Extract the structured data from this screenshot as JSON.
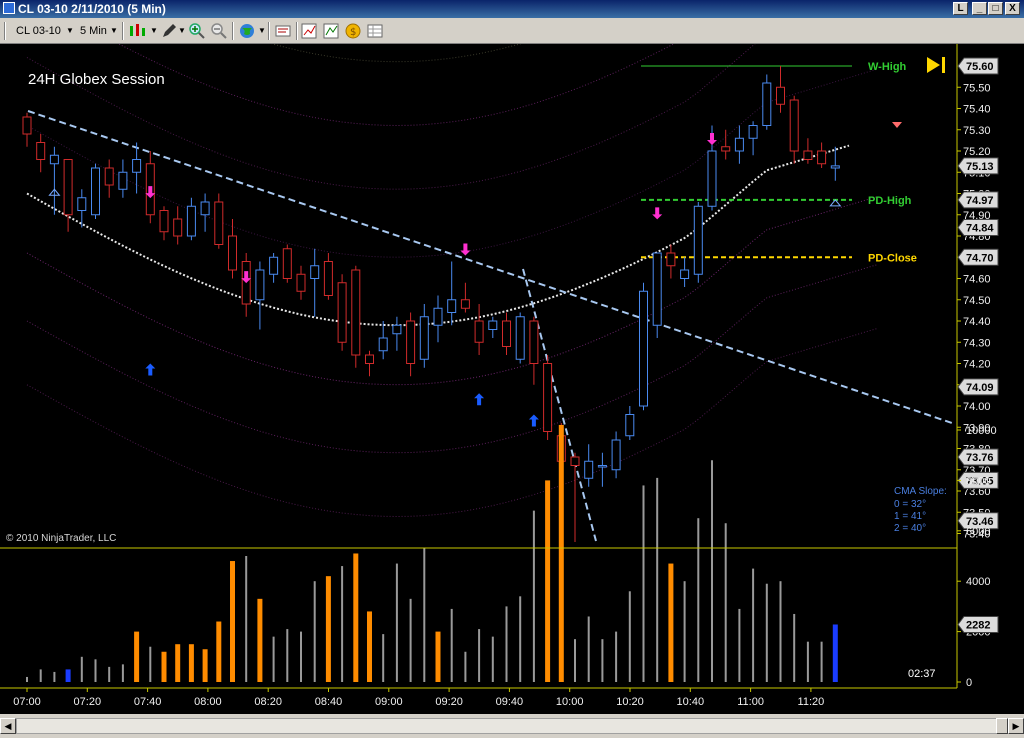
{
  "window": {
    "title": "CL 03-10  2/11/2010 (5 Min)",
    "controls": [
      "L",
      "_",
      "□",
      "X"
    ]
  },
  "toolbar": {
    "instrument": "CL 03-10",
    "interval": "5 Min",
    "icons": [
      "bars-icon",
      "pencil-icon",
      "zoom-in-icon",
      "zoom-out-icon",
      "globe-icon",
      "properties-icon",
      "chart-trader-icon",
      "coin-icon",
      "data-box-icon"
    ]
  },
  "chart": {
    "session_label": "24H Globex Session",
    "copyright": "© 2010 NinjaTrader, LLC",
    "price_ticks": [
      "75.50",
      "75.40",
      "75.30",
      "75.20",
      "75.10",
      "75.00",
      "74.90",
      "74.80",
      "74.70",
      "74.60",
      "74.50",
      "74.40",
      "74.30",
      "74.20",
      "74.10",
      "74.00",
      "73.90",
      "73.80",
      "73.70",
      "73.60",
      "73.50",
      "73.40"
    ],
    "price_labels": [
      {
        "value": "75.60",
        "color": "#dcdcdc"
      },
      {
        "value": "75.13",
        "color": "#dcdcdc"
      },
      {
        "value": "74.97",
        "color": "#dcdcdc"
      },
      {
        "value": "74.84",
        "color": "#dcdcdc"
      },
      {
        "value": "74.70",
        "color": "#dcdcdc"
      },
      {
        "value": "74.09",
        "color": "#dcdcdc"
      },
      {
        "value": "73.76",
        "color": "#dcdcdc"
      },
      {
        "value": "73.65",
        "color": "#dcdcdc"
      },
      {
        "value": "73.46",
        "color": "#dcdcdc"
      }
    ],
    "levels": [
      {
        "name": "W-High",
        "value": 75.6,
        "color": "#32cd32"
      },
      {
        "name": "PD-High",
        "value": 74.97,
        "color": "#32cd32"
      },
      {
        "name": "PD-Close",
        "value": 74.7,
        "color": "#ffd700"
      }
    ],
    "cma": {
      "title": "CMA Slope:",
      "lines": [
        "0 = 32°",
        "1 = 41°",
        "2 = 40°"
      ]
    },
    "volume_ticks": [
      "10000",
      "8000",
      "6000",
      "4000",
      "2000",
      "0"
    ],
    "volume_last": "2282",
    "time_ticks": [
      "07:00",
      "07:20",
      "07:40",
      "08:00",
      "08:20",
      "08:40",
      "09:00",
      "09:20",
      "09:40",
      "10:00",
      "10:20",
      "10:40",
      "11:00",
      "11:20"
    ],
    "timer": "02:37"
  },
  "chart_data": {
    "type": "candlestick",
    "interval": "5 Min",
    "candles": [
      {
        "o": 75.36,
        "h": 75.38,
        "l": 75.22,
        "c": 75.28
      },
      {
        "o": 75.24,
        "h": 75.28,
        "l": 75.1,
        "c": 75.16
      },
      {
        "o": 75.14,
        "h": 75.22,
        "l": 74.9,
        "c": 75.18
      },
      {
        "o": 75.16,
        "h": 75.16,
        "l": 74.82,
        "c": 74.9
      },
      {
        "o": 74.92,
        "h": 75.02,
        "l": 74.84,
        "c": 74.98
      },
      {
        "o": 74.9,
        "h": 75.14,
        "l": 74.88,
        "c": 75.12
      },
      {
        "o": 75.12,
        "h": 75.16,
        "l": 74.98,
        "c": 75.04
      },
      {
        "o": 75.02,
        "h": 75.16,
        "l": 74.98,
        "c": 75.1
      },
      {
        "o": 75.1,
        "h": 75.24,
        "l": 75.0,
        "c": 75.16
      },
      {
        "o": 75.14,
        "h": 75.2,
        "l": 74.86,
        "c": 74.9
      },
      {
        "o": 74.92,
        "h": 74.94,
        "l": 74.78,
        "c": 74.82
      },
      {
        "o": 74.88,
        "h": 74.94,
        "l": 74.76,
        "c": 74.8
      },
      {
        "o": 74.8,
        "h": 74.98,
        "l": 74.78,
        "c": 74.94
      },
      {
        "o": 74.9,
        "h": 75.0,
        "l": 74.82,
        "c": 74.96
      },
      {
        "o": 74.96,
        "h": 75.0,
        "l": 74.74,
        "c": 74.76
      },
      {
        "o": 74.8,
        "h": 74.88,
        "l": 74.6,
        "c": 74.64
      },
      {
        "o": 74.68,
        "h": 74.72,
        "l": 74.42,
        "c": 74.48
      },
      {
        "o": 74.5,
        "h": 74.68,
        "l": 74.36,
        "c": 74.64
      },
      {
        "o": 74.62,
        "h": 74.72,
        "l": 74.58,
        "c": 74.7
      },
      {
        "o": 74.74,
        "h": 74.76,
        "l": 74.58,
        "c": 74.6
      },
      {
        "o": 74.62,
        "h": 74.66,
        "l": 74.5,
        "c": 74.54
      },
      {
        "o": 74.6,
        "h": 74.74,
        "l": 74.42,
        "c": 74.66
      },
      {
        "o": 74.68,
        "h": 74.72,
        "l": 74.5,
        "c": 74.52
      },
      {
        "o": 74.58,
        "h": 74.62,
        "l": 74.26,
        "c": 74.3
      },
      {
        "o": 74.64,
        "h": 74.66,
        "l": 74.18,
        "c": 74.24
      },
      {
        "o": 74.24,
        "h": 74.26,
        "l": 74.14,
        "c": 74.2
      },
      {
        "o": 74.26,
        "h": 74.4,
        "l": 74.22,
        "c": 74.32
      },
      {
        "o": 74.34,
        "h": 74.42,
        "l": 74.26,
        "c": 74.38
      },
      {
        "o": 74.4,
        "h": 74.44,
        "l": 74.14,
        "c": 74.2
      },
      {
        "o": 74.22,
        "h": 74.48,
        "l": 74.18,
        "c": 74.42
      },
      {
        "o": 74.38,
        "h": 74.52,
        "l": 74.3,
        "c": 74.46
      },
      {
        "o": 74.44,
        "h": 74.68,
        "l": 74.38,
        "c": 74.5
      },
      {
        "o": 74.5,
        "h": 74.58,
        "l": 74.44,
        "c": 74.46
      },
      {
        "o": 74.4,
        "h": 74.48,
        "l": 74.24,
        "c": 74.3
      },
      {
        "o": 74.36,
        "h": 74.42,
        "l": 74.32,
        "c": 74.4
      },
      {
        "o": 74.4,
        "h": 74.44,
        "l": 74.24,
        "c": 74.28
      },
      {
        "o": 74.22,
        "h": 74.44,
        "l": 74.2,
        "c": 74.42
      },
      {
        "o": 74.4,
        "h": 74.42,
        "l": 74.1,
        "c": 74.2
      },
      {
        "o": 74.2,
        "h": 74.24,
        "l": 73.84,
        "c": 73.88
      },
      {
        "o": 73.86,
        "h": 73.92,
        "l": 73.6,
        "c": 73.74
      },
      {
        "o": 73.76,
        "h": 73.78,
        "l": 73.36,
        "c": 73.72
      },
      {
        "o": 73.66,
        "h": 73.82,
        "l": 73.62,
        "c": 73.74
      },
      {
        "o": 73.72,
        "h": 73.78,
        "l": 73.62,
        "c": 73.72
      },
      {
        "o": 73.7,
        "h": 73.88,
        "l": 73.66,
        "c": 73.84
      },
      {
        "o": 73.86,
        "h": 74.0,
        "l": 73.84,
        "c": 73.96
      },
      {
        "o": 74.0,
        "h": 74.58,
        "l": 73.98,
        "c": 74.54
      },
      {
        "o": 74.38,
        "h": 74.72,
        "l": 74.32,
        "c": 74.72
      },
      {
        "o": 74.72,
        "h": 74.76,
        "l": 74.6,
        "c": 74.66
      },
      {
        "o": 74.6,
        "h": 74.7,
        "l": 74.56,
        "c": 74.64
      },
      {
        "o": 74.62,
        "h": 74.96,
        "l": 74.58,
        "c": 74.94
      },
      {
        "o": 74.94,
        "h": 75.32,
        "l": 74.92,
        "c": 75.2
      },
      {
        "o": 75.22,
        "h": 75.3,
        "l": 75.16,
        "c": 75.2
      },
      {
        "o": 75.2,
        "h": 75.32,
        "l": 75.14,
        "c": 75.26
      },
      {
        "o": 75.26,
        "h": 75.34,
        "l": 75.18,
        "c": 75.32
      },
      {
        "o": 75.32,
        "h": 75.56,
        "l": 75.3,
        "c": 75.52
      },
      {
        "o": 75.5,
        "h": 75.6,
        "l": 75.38,
        "c": 75.42
      },
      {
        "o": 75.44,
        "h": 75.46,
        "l": 75.14,
        "c": 75.2
      },
      {
        "o": 75.2,
        "h": 75.26,
        "l": 75.14,
        "c": 75.16
      },
      {
        "o": 75.2,
        "h": 75.24,
        "l": 75.12,
        "c": 75.14
      },
      {
        "o": 75.12,
        "h": 75.22,
        "l": 75.06,
        "c": 75.13
      }
    ],
    "volume": [
      {
        "v": 200,
        "c": "gray"
      },
      {
        "v": 500,
        "c": "gray"
      },
      {
        "v": 400,
        "c": "gray"
      },
      {
        "v": 500,
        "c": "blue"
      },
      {
        "v": 1000,
        "c": "gray"
      },
      {
        "v": 900,
        "c": "gray"
      },
      {
        "v": 600,
        "c": "gray"
      },
      {
        "v": 700,
        "c": "gray"
      },
      {
        "v": 2000,
        "c": "orange"
      },
      {
        "v": 1400,
        "c": "gray"
      },
      {
        "v": 1200,
        "c": "orange"
      },
      {
        "v": 1500,
        "c": "orange"
      },
      {
        "v": 1500,
        "c": "orange"
      },
      {
        "v": 1300,
        "c": "orange"
      },
      {
        "v": 2400,
        "c": "orange"
      },
      {
        "v": 4800,
        "c": "orange"
      },
      {
        "v": 5000,
        "c": "gray"
      },
      {
        "v": 3300,
        "c": "orange"
      },
      {
        "v": 1800,
        "c": "gray"
      },
      {
        "v": 2100,
        "c": "gray"
      },
      {
        "v": 2000,
        "c": "gray"
      },
      {
        "v": 4000,
        "c": "gray"
      },
      {
        "v": 4200,
        "c": "orange"
      },
      {
        "v": 4600,
        "c": "gray"
      },
      {
        "v": 5100,
        "c": "orange"
      },
      {
        "v": 2800,
        "c": "orange"
      },
      {
        "v": 1900,
        "c": "gray"
      },
      {
        "v": 4700,
        "c": "gray"
      },
      {
        "v": 3300,
        "c": "gray"
      },
      {
        "v": 5300,
        "c": "gray"
      },
      {
        "v": 2000,
        "c": "orange"
      },
      {
        "v": 2900,
        "c": "gray"
      },
      {
        "v": 1200,
        "c": "gray"
      },
      {
        "v": 2100,
        "c": "gray"
      },
      {
        "v": 1800,
        "c": "gray"
      },
      {
        "v": 3000,
        "c": "gray"
      },
      {
        "v": 3400,
        "c": "gray"
      },
      {
        "v": 6800,
        "c": "gray"
      },
      {
        "v": 8000,
        "c": "orange"
      },
      {
        "v": 10200,
        "c": "orange"
      },
      {
        "v": 1700,
        "c": "gray"
      },
      {
        "v": 2600,
        "c": "gray"
      },
      {
        "v": 1700,
        "c": "gray"
      },
      {
        "v": 2000,
        "c": "gray"
      },
      {
        "v": 3600,
        "c": "gray"
      },
      {
        "v": 7800,
        "c": "gray"
      },
      {
        "v": 8100,
        "c": "gray"
      },
      {
        "v": 4700,
        "c": "orange"
      },
      {
        "v": 4000,
        "c": "gray"
      },
      {
        "v": 6500,
        "c": "gray"
      },
      {
        "v": 8800,
        "c": "gray"
      },
      {
        "v": 6300,
        "c": "gray"
      },
      {
        "v": 2900,
        "c": "gray"
      },
      {
        "v": 4500,
        "c": "gray"
      },
      {
        "v": 3900,
        "c": "gray"
      },
      {
        "v": 4000,
        "c": "gray"
      },
      {
        "v": 2700,
        "c": "gray"
      },
      {
        "v": 1600,
        "c": "gray"
      },
      {
        "v": 1600,
        "c": "gray"
      },
      {
        "v": 2282,
        "c": "blue"
      }
    ]
  }
}
